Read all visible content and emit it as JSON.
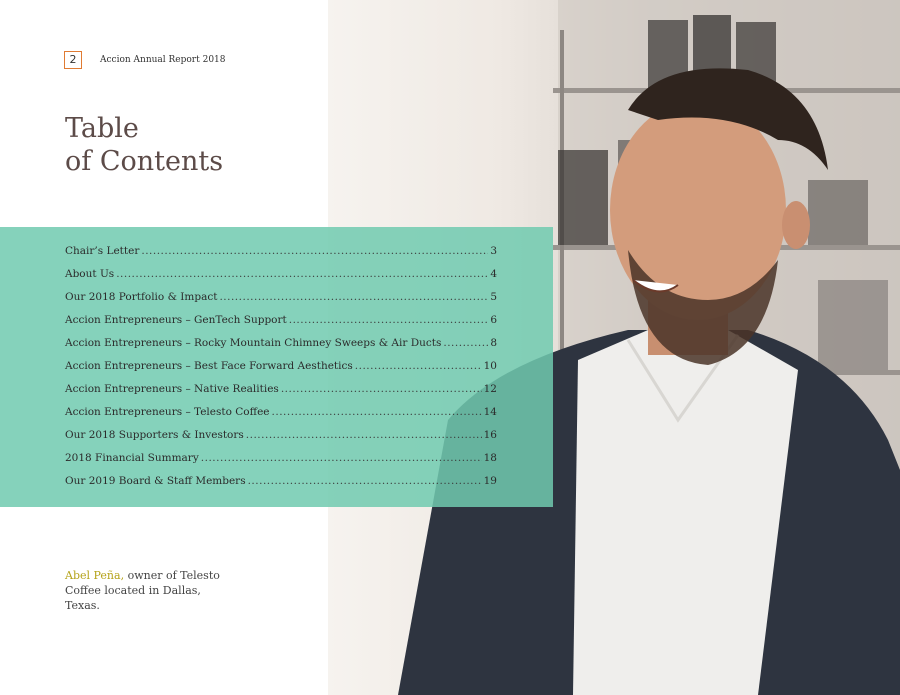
{
  "header": {
    "page_number": "2",
    "running_head": "Accion Annual Report 2018"
  },
  "title": {
    "line1": "Table",
    "line2": "of Contents"
  },
  "toc": {
    "entries": [
      {
        "label": "Chair’s Letter",
        "page": "3"
      },
      {
        "label": "About Us",
        "page": "4"
      },
      {
        "label": "Our 2018 Portfolio & Impact",
        "page": "5"
      },
      {
        "label": "Accion Entrepreneurs – GenTech Support",
        "page": "6"
      },
      {
        "label": "Accion Entrepreneurs – Rocky Mountain Chimney Sweeps & Air Ducts",
        "page": "8"
      },
      {
        "label": "Accion Entrepreneurs – Best Face Forward Aesthetics",
        "page": "10"
      },
      {
        "label": "Accion Entrepreneurs – Native Realities",
        "page": "12"
      },
      {
        "label": "Accion Entrepreneurs – Telesto Coffee",
        "page": "14"
      },
      {
        "label": "Our 2018 Supporters & Investors",
        "page": "16"
      },
      {
        "label": "2018 Financial Summary",
        "page": "18"
      },
      {
        "label": "Our 2019 Board & Staff Members",
        "page": "19"
      }
    ]
  },
  "caption": {
    "name": "Abel Peña,",
    "text": " owner of Telesto Coffee located in Dallas, Texas."
  },
  "colors": {
    "accent_orange": "#e07b33",
    "teal_band": "#70caaf",
    "title_brown": "#5c4b48",
    "caption_highlight": "#b5a31a"
  }
}
